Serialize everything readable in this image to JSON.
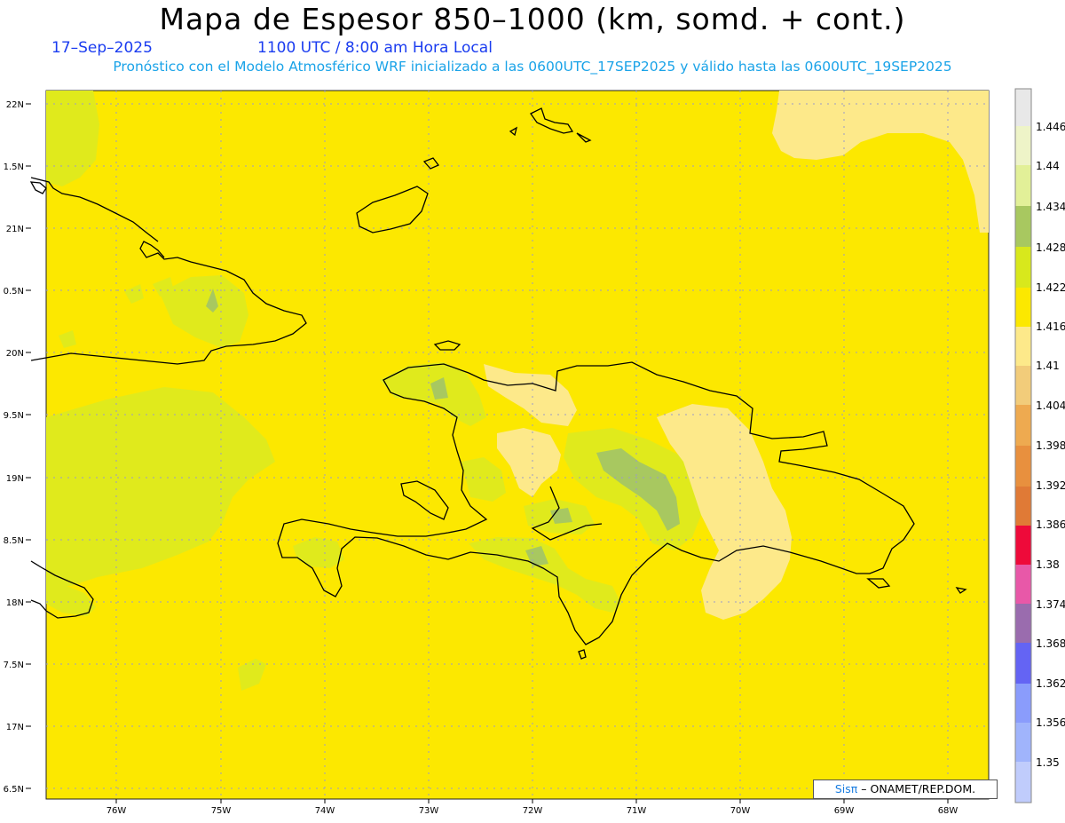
{
  "header": {
    "title": "Mapa de Espesor 850–1000 (km, somd. + cont.)",
    "date": "17–Sep–2025",
    "time": "1100 UTC / 8:00 am Hora Local",
    "forecast_info": "Pronóstico con el Modelo Atmosférico WRF inicializado a las 0600UTC_17SEP2025 y válido hasta las  0600UTC_19SEP2025"
  },
  "map": {
    "lat_labels": [
      "22N",
      "1.5N",
      "21N",
      "0.5N",
      "20N",
      "9.5N",
      "19N",
      "8.5N",
      "18N",
      "7.5N",
      "17N",
      "6.5N"
    ],
    "lon_labels": [
      "76W",
      "75W",
      "74W",
      "73W",
      "72W",
      "71W",
      "70W",
      "69W",
      "68W"
    ],
    "background_color": "#fce800",
    "grid": true
  },
  "legend": {
    "levels": [
      "1.446",
      "1.44",
      "1.434",
      "1.428",
      "1.422",
      "1.416",
      "1.41",
      "1.404",
      "1.398",
      "1.392",
      "1.386",
      "1.38",
      "1.374",
      "1.368",
      "1.362",
      "1.356",
      "1.35"
    ],
    "colors": [
      "#e8e8e8",
      "#eef4c8",
      "#e2f098",
      "#a8c860",
      "#d8e81c",
      "#fce800",
      "#fde98a",
      "#f2cc7a",
      "#eeaa50",
      "#e8903e",
      "#e07a36",
      "#ee0a3a",
      "#e858a8",
      "#9a6cae",
      "#6464f4",
      "#8a9cfc",
      "#a0b4fc",
      "#c0ccfc"
    ]
  },
  "credit": {
    "logo": "Sisπ",
    "text": "– ONAMET/REP.DOM."
  }
}
